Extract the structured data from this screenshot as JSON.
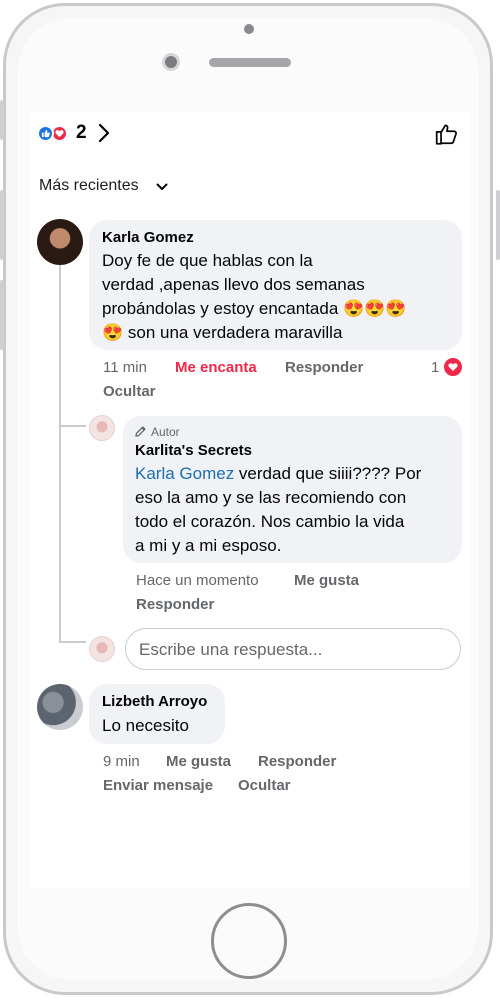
{
  "header": {
    "reaction_count": "2",
    "reactions": [
      "like-icon",
      "love-icon"
    ],
    "like_button_icon": "thumbs-up-outline-icon"
  },
  "sort": {
    "label": "Más recientes"
  },
  "comments": [
    {
      "author": "Karla Gomez",
      "text_lines": [
        "Doy fe de que hablas con la",
        "verdad ,apenas llevo dos semanas",
        "probándolas y estoy encantada 😍😍😍",
        "😍 son una verdadera maravilla"
      ],
      "time": "11 min",
      "reaction_label": "Me encanta",
      "reply_label": "Responder",
      "hide_label": "Ocultar",
      "reaction_count": "1",
      "replies": [
        {
          "badge": "Autor",
          "author": "Karlita's Secrets",
          "mention": "Karla Gomez",
          "text_first_line_rest": " verdad que siiii???? Por",
          "text_lines": [
            "eso la amo y se las recomiendo con",
            "todo el corazón. Nos cambio la vida",
            "a mi y a mi esposo."
          ],
          "time": "Hace un momento",
          "like_label": "Me gusta",
          "reply_label": "Responder"
        }
      ],
      "reply_input_placeholder": "Escribe una respuesta..."
    },
    {
      "author": "Lizbeth Arroyo",
      "text": "Lo necesito",
      "time": "9 min",
      "like_label": "Me gusta",
      "reply_label": "Responder",
      "message_label": "Enviar mensaje",
      "hide_label": "Ocultar"
    }
  ],
  "colors": {
    "like_blue": "#1b74e4",
    "love_red": "#f02849",
    "mention_blue": "#1a6fb5",
    "bubble_gray": "#f0f2f5",
    "meta_gray": "#65676b"
  }
}
